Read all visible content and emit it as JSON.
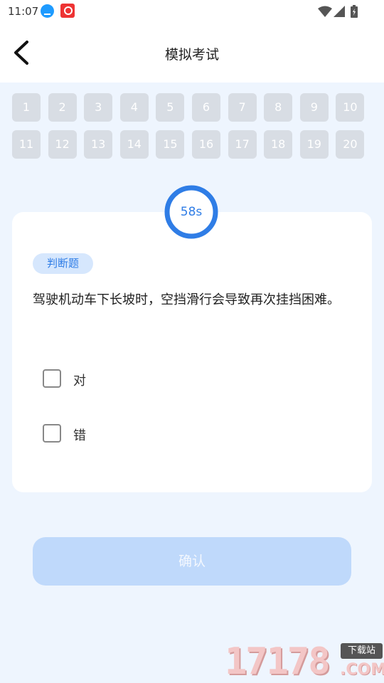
{
  "status_bar": {
    "time": "11:07"
  },
  "header": {
    "title": "模拟考试"
  },
  "question_numbers": [
    "1",
    "2",
    "3",
    "4",
    "5",
    "6",
    "7",
    "8",
    "9",
    "10",
    "11",
    "12",
    "13",
    "14",
    "15",
    "16",
    "17",
    "18",
    "19",
    "20"
  ],
  "timer": {
    "text": "58s",
    "progress": 1.0,
    "color": "#2f7de6"
  },
  "question": {
    "type_tag": "判断题",
    "text": "驾驶机动车下长坡时，空挡滑行会导致再次挂挡困难。",
    "options": [
      "对",
      "错"
    ]
  },
  "confirm_label": "确认",
  "watermark": {
    "main": "17178",
    "badge": "下载站",
    "suffix": ".COM"
  }
}
